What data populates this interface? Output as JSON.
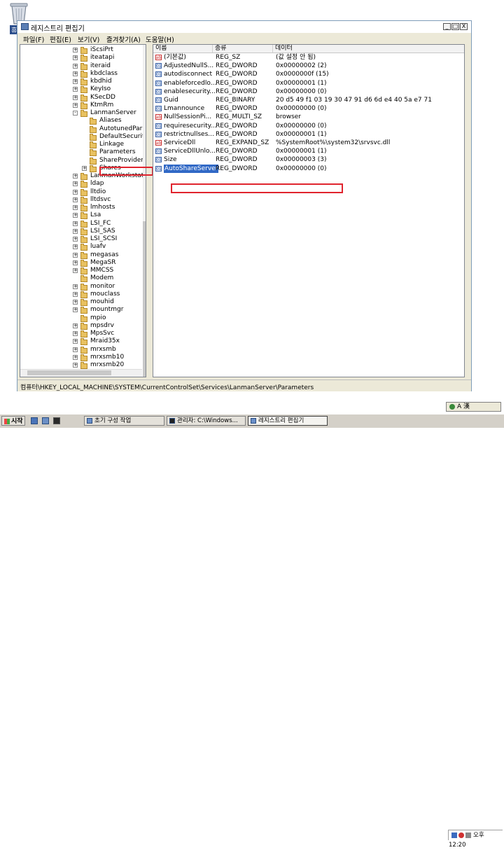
{
  "desktop": {
    "recycle_label": "휴"
  },
  "window": {
    "title": "레지스트리 편집기",
    "buttons": {
      "minimize": "_",
      "maximize": "□",
      "close": "X"
    }
  },
  "menu": [
    {
      "label": "파일(F)"
    },
    {
      "label": "편집(E)"
    },
    {
      "label": "보기(V)"
    },
    {
      "label": "즐겨찾기(A)"
    },
    {
      "label": "도움말(H)"
    }
  ],
  "tree": {
    "items": [
      {
        "label": "iScsiPrt",
        "level": 0,
        "expander": "+"
      },
      {
        "label": "iteatapi",
        "level": 0,
        "expander": "+"
      },
      {
        "label": "iteraid",
        "level": 0,
        "expander": "+"
      },
      {
        "label": "kbdclass",
        "level": 0,
        "expander": "+"
      },
      {
        "label": "kbdhid",
        "level": 0,
        "expander": "+"
      },
      {
        "label": "KeyIso",
        "level": 0,
        "expander": "+"
      },
      {
        "label": "KSecDD",
        "level": 0,
        "expander": "+"
      },
      {
        "label": "KtmRm",
        "level": 0,
        "expander": "+"
      },
      {
        "label": "LanmanServer",
        "level": 0,
        "expander": "-"
      },
      {
        "label": "Aliases",
        "level": 1,
        "expander": ""
      },
      {
        "label": "AutotunedParar",
        "level": 1,
        "expander": ""
      },
      {
        "label": "DefaultSecurity",
        "level": 1,
        "expander": ""
      },
      {
        "label": "Linkage",
        "level": 1,
        "expander": ""
      },
      {
        "label": "Parameters",
        "level": 1,
        "expander": ""
      },
      {
        "label": "ShareProviders",
        "level": 1,
        "expander": ""
      },
      {
        "label": "Shares",
        "level": 1,
        "expander": "+"
      },
      {
        "label": "LanmanWorkstatior",
        "level": 0,
        "expander": "+"
      },
      {
        "label": "ldap",
        "level": 0,
        "expander": "+"
      },
      {
        "label": "lltdio",
        "level": 0,
        "expander": "+"
      },
      {
        "label": "lltdsvc",
        "level": 0,
        "expander": "+"
      },
      {
        "label": "lmhosts",
        "level": 0,
        "expander": "+"
      },
      {
        "label": "Lsa",
        "level": 0,
        "expander": "+"
      },
      {
        "label": "LSI_FC",
        "level": 0,
        "expander": "+"
      },
      {
        "label": "LSI_SAS",
        "level": 0,
        "expander": "+"
      },
      {
        "label": "LSI_SCSI",
        "level": 0,
        "expander": "+"
      },
      {
        "label": "luafv",
        "level": 0,
        "expander": "+"
      },
      {
        "label": "megasas",
        "level": 0,
        "expander": "+"
      },
      {
        "label": "MegaSR",
        "level": 0,
        "expander": "+"
      },
      {
        "label": "MMCSS",
        "level": 0,
        "expander": "+"
      },
      {
        "label": "Modem",
        "level": 0,
        "expander": ""
      },
      {
        "label": "monitor",
        "level": 0,
        "expander": "+"
      },
      {
        "label": "mouclass",
        "level": 0,
        "expander": "+"
      },
      {
        "label": "mouhid",
        "level": 0,
        "expander": "+"
      },
      {
        "label": "mountmgr",
        "level": 0,
        "expander": "+"
      },
      {
        "label": "mpio",
        "level": 0,
        "expander": ""
      },
      {
        "label": "mpsdrv",
        "level": 0,
        "expander": "+"
      },
      {
        "label": "MpsSvc",
        "level": 0,
        "expander": "+"
      },
      {
        "label": "Mraid35x",
        "level": 0,
        "expander": "+"
      },
      {
        "label": "mrxsmb",
        "level": 0,
        "expander": "+"
      },
      {
        "label": "mrxsmb10",
        "level": 0,
        "expander": "+"
      },
      {
        "label": "mrxsmb20",
        "level": 0,
        "expander": "+"
      }
    ]
  },
  "list": {
    "columns": [
      "이름",
      "종류",
      "데이터"
    ],
    "rows": [
      {
        "icon": "ab",
        "name": "(기본값)",
        "type": "REG_SZ",
        "data": "(값 설정 안 됨)"
      },
      {
        "icon": "bin",
        "name": "AdjustedNullS...",
        "type": "REG_DWORD",
        "data": "0x00000002 (2)"
      },
      {
        "icon": "bin",
        "name": "autodisconnect",
        "type": "REG_DWORD",
        "data": "0x0000000f (15)"
      },
      {
        "icon": "bin",
        "name": "enableforcedlo...",
        "type": "REG_DWORD",
        "data": "0x00000001 (1)"
      },
      {
        "icon": "bin",
        "name": "enablesecurity...",
        "type": "REG_DWORD",
        "data": "0x00000000 (0)"
      },
      {
        "icon": "bin",
        "name": "Guid",
        "type": "REG_BINARY",
        "data": "20 d5 49 f1 03 19 30 47 91 d6 6d e4 40 5a e7 71"
      },
      {
        "icon": "bin",
        "name": "Lmannounce",
        "type": "REG_DWORD",
        "data": "0x00000000 (0)"
      },
      {
        "icon": "ab",
        "name": "NullSessionPi...",
        "type": "REG_MULTI_SZ",
        "data": "browser"
      },
      {
        "icon": "bin",
        "name": "requiresecurity...",
        "type": "REG_DWORD",
        "data": "0x00000000 (0)"
      },
      {
        "icon": "bin",
        "name": "restrictnullses...",
        "type": "REG_DWORD",
        "data": "0x00000001 (1)"
      },
      {
        "icon": "ab",
        "name": "ServiceDll",
        "type": "REG_EXPAND_SZ",
        "data": "%SystemRoot%\\system32\\srvsvc.dll"
      },
      {
        "icon": "bin",
        "name": "ServiceDllUnlo...",
        "type": "REG_DWORD",
        "data": "0x00000001 (1)"
      },
      {
        "icon": "bin",
        "name": "Size",
        "type": "REG_DWORD",
        "data": "0x00000003 (3)"
      },
      {
        "icon": "bin",
        "name": "AutoShareServer",
        "type": "REG_DWORD",
        "data": "0x00000000 (0)"
      }
    ]
  },
  "statusbar": {
    "path": "컴퓨터\\HKEY_LOCAL_MACHINE\\SYSTEM\\CurrentControlSet\\Services\\LanmanServer\\Parameters"
  },
  "taskbar": {
    "start_label": "시작",
    "buttons": [
      {
        "label": "초기 구성 작업"
      },
      {
        "label": "관리자: C:\\Windows..."
      },
      {
        "label": "레지스트리 편집기"
      }
    ],
    "ime_label": "A 漢",
    "clock": "오후 12:20"
  }
}
